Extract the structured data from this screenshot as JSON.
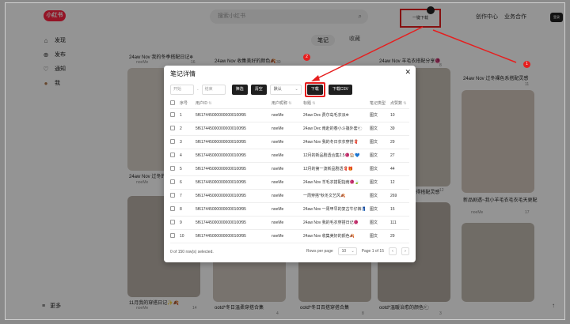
{
  "app": {
    "logo": "小红书",
    "search_placeholder": "搜索小红书",
    "nav_creator": "创作中心",
    "nav_business": "业务合作",
    "download_badge": "一键下载",
    "side_tab": "登录"
  },
  "sidebar": {
    "items": [
      {
        "label": "发现",
        "icon": "⌂"
      },
      {
        "label": "发布",
        "icon": "⊕"
      },
      {
        "label": "通知",
        "icon": "♡"
      },
      {
        "label": "我",
        "icon": "●"
      }
    ],
    "more": "更多"
  },
  "tabs": {
    "notes": "笔记",
    "collect": "收藏"
  },
  "feed": [
    {
      "title": "24aw Nov 我的冬季搭配日记❄",
      "author": "noeMe",
      "likes": "16"
    },
    {
      "title": "24aw Nov 收集美好的颜色🍂",
      "author": "noeMe",
      "likes": "30"
    },
    {
      "title": "24aw Nov 羊毛衣搭配分享🧶",
      "author": "noeMe",
      "likes": "8"
    },
    {
      "title": "24aw Nov 过冬裸色系搭配灵感",
      "author": "noeMe",
      "likes": "11"
    },
    {
      "title": "24aw Nov 过冬的黑色大衣穿搭",
      "author": "noeMe",
      "likes": "8"
    },
    {
      "title": "24aw Nov 过冬心得搭配灵感",
      "author": "noeMe",
      "likes": "12"
    },
    {
      "title": "新品剧透~我小羊毛衣毛衣毛天更配",
      "author": "noeMe",
      "likes": "17"
    },
    {
      "title": "11月我的穿搭日记✨🍂",
      "author": "noeMe",
      "likes": "14"
    },
    {
      "title": "ootd*冬日温柔穿搭合集",
      "author": "noeMe",
      "likes": "4"
    },
    {
      "title": "ootd*冬日百搭穿搭合集",
      "author": "noeMe",
      "likes": "8"
    },
    {
      "title": "ootd*温暖治愈的颜色🐑",
      "author": "noeMe",
      "likes": "3"
    }
  ],
  "dialog": {
    "title": "笔记详情",
    "close": "✕",
    "filters": {
      "start_placeholder": "开始",
      "end_placeholder": "结束",
      "filter_btn": "筛选",
      "clear_btn": "清空",
      "select_value": "默认",
      "download_btn": "下载",
      "csv_btn": "下载CSV"
    },
    "columns": [
      "序号",
      "用户ID",
      "用户昵称",
      "标题",
      "笔记类型",
      "点赞数"
    ],
    "rows": [
      {
        "idx": "1",
        "uid": "5f6174450000000000100f95",
        "nick": "noeMe",
        "title": "24aw Dec 费尔岛毛衣派❄",
        "type": "图文",
        "likes": "10"
      },
      {
        "idx": "2",
        "uid": "5f6174450000000000100f95",
        "nick": "noeMe",
        "title": "24aw Dec 南赴的春小斗篷外套🐑",
        "type": "图文",
        "likes": "39"
      },
      {
        "idx": "3",
        "uid": "5f6174450000000000100f95",
        "nick": "noeMe",
        "title": "24aw Nov 我的冬日衣衣穿搭🧣",
        "type": "图文",
        "likes": "29"
      },
      {
        "idx": "4",
        "uid": "5f6174450000000000100f95",
        "nick": "noeMe",
        "title": "12月的新品剧透合集2.5🧶🏠💙",
        "type": "图文",
        "likes": "27"
      },
      {
        "idx": "5",
        "uid": "5f6174450000000000100f95",
        "nick": "noeMe",
        "title": "12月的第一波新品剧透🧣🎁",
        "type": "图文",
        "likes": "44"
      },
      {
        "idx": "6",
        "uid": "5f6174450000000000100f95",
        "nick": "noeMe",
        "title": "24aw Nov 羊毛衣搭配指南🧶🍃",
        "type": "图文",
        "likes": "12"
      },
      {
        "idx": "7",
        "uid": "5f6174450000000000100f95",
        "nick": "noeMe",
        "title": "一周穿搭*秋冬文艺风🍂",
        "type": "图文",
        "likes": "269"
      },
      {
        "idx": "8",
        "uid": "5f6174450000000000100f95",
        "nick": "noeMe",
        "title": "24aw Nov 一周甲早的复古牛仔裤👖",
        "type": "图文",
        "likes": "15"
      },
      {
        "idx": "9",
        "uid": "5f6174450000000000100f95",
        "nick": "noeMe",
        "title": "24aw Nov 我的毛衣穿搭日记🧶",
        "type": "图文",
        "likes": "111"
      },
      {
        "idx": "10",
        "uid": "5f6174450000000000100f95",
        "nick": "noeMe",
        "title": "24aw Nov 收集美好的颜色🍂",
        "type": "图文",
        "likes": "29"
      }
    ],
    "pager": {
      "selected": "0 of 150 row(s) selected.",
      "rows_per_page_label": "Rows per page",
      "rows_per_page": "10",
      "page_info": "Page 1 of 15",
      "prev": "‹",
      "next": "›"
    }
  },
  "annotations": {
    "step1": "1",
    "step2": "2"
  },
  "colors": {
    "brand": "#ff2442",
    "annotation": "#e61e1e",
    "dark_button": "#1f1f1f"
  }
}
